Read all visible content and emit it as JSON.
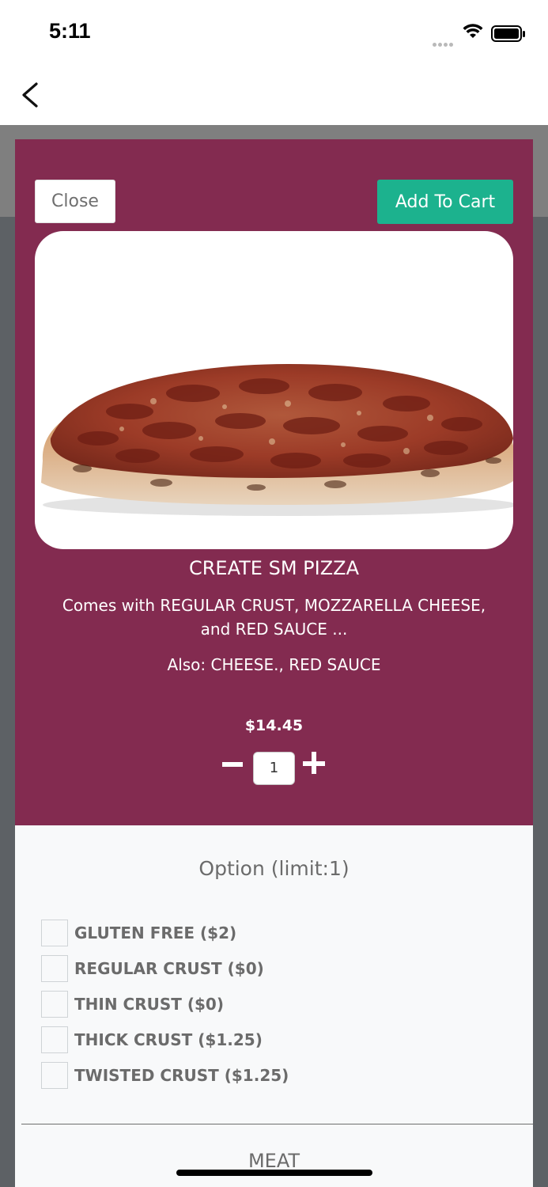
{
  "status_bar": {
    "time": "5:11"
  },
  "modal": {
    "close_label": "Close",
    "add_to_cart_label": "Add To Cart",
    "product": {
      "title": "CREATE SM PIZZA",
      "description": "Comes with REGULAR CRUST, MOZZARELLA CHEESE, and RED SAUCE ...",
      "also": "Also: CHEESE., RED SAUCE",
      "price": "$14.45",
      "quantity": "1"
    },
    "options": {
      "title": "Option (limit:1)",
      "items": [
        {
          "label": "GLUTEN FREE ($2)",
          "checked": false
        },
        {
          "label": "REGULAR CRUST ($0)",
          "checked": false
        },
        {
          "label": "THIN CRUST ($0)",
          "checked": false
        },
        {
          "label": "THICK CRUST ($1.25)",
          "checked": false
        },
        {
          "label": "TWISTED CRUST ($1.25)",
          "checked": false
        }
      ]
    },
    "next_section_title": "MEAT"
  },
  "colors": {
    "header_bg": "#832b50",
    "accent_green": "#1cb28e",
    "panel_bg": "#f8f9fa"
  }
}
